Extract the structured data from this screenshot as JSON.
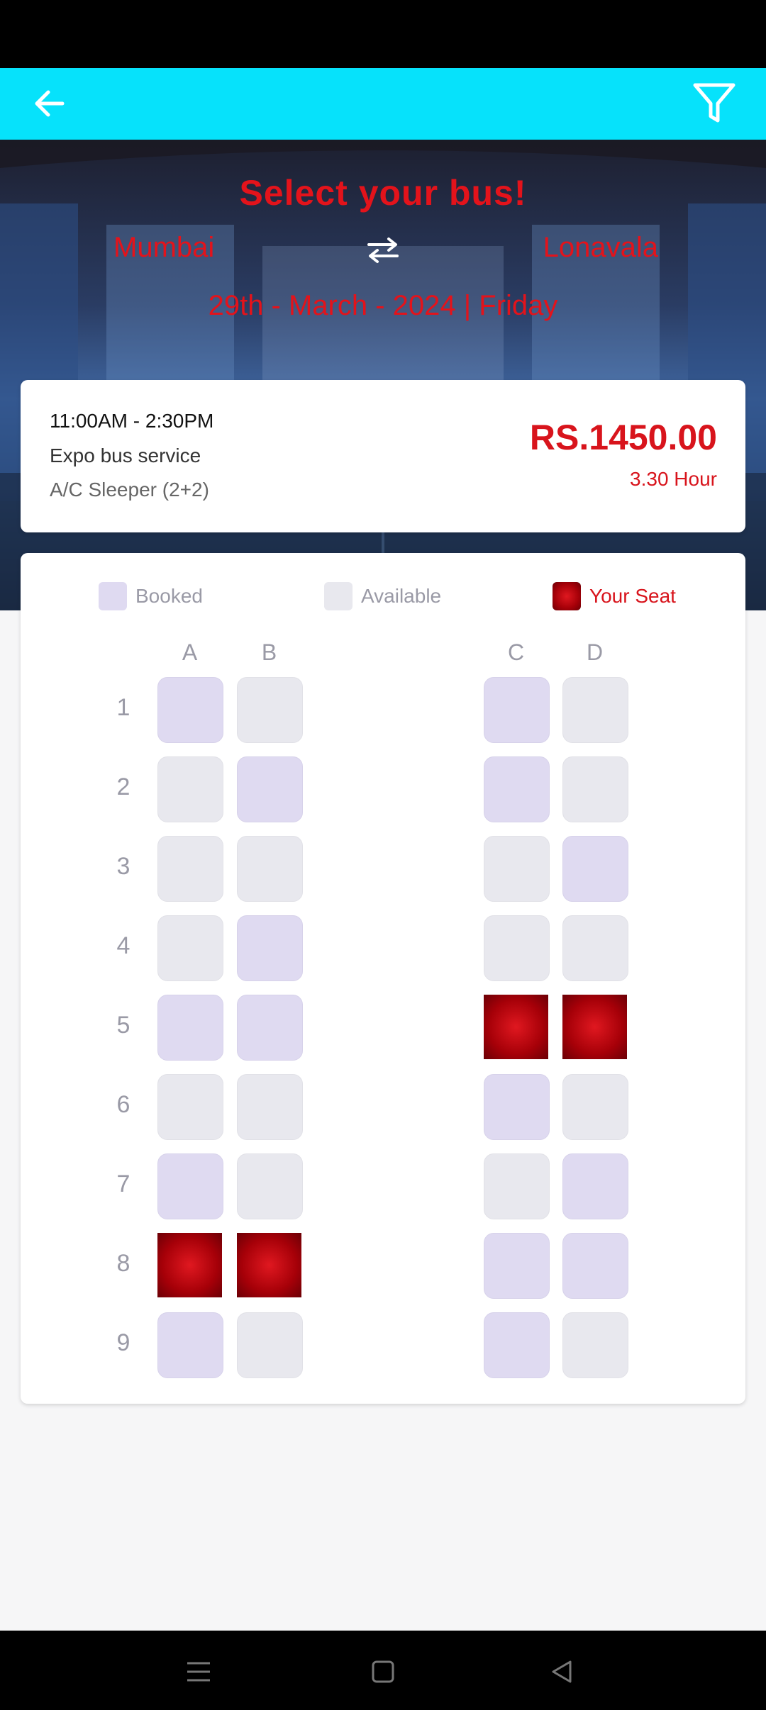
{
  "header": {
    "back_icon": "arrow-left-icon",
    "filter_icon": "filter-icon",
    "bar_color": "#06e2fb"
  },
  "hero": {
    "title": "Select your bus!",
    "from": "Mumbai",
    "to": "Lonavala",
    "swap_icon": "swap-arrows-icon",
    "date": "29th - March - 2024 | Friday"
  },
  "bus": {
    "time": "11:00AM - 2:30PM",
    "name": "Expo bus service",
    "type": "A/C Sleeper (2+2)",
    "price": "RS.1450.00",
    "duration": "3.30 Hour"
  },
  "legend": {
    "booked": "Booked",
    "available": "Available",
    "your_seat": "Your Seat"
  },
  "seat_map": {
    "columns": [
      "A",
      "B",
      "C",
      "D"
    ],
    "rows": [
      {
        "label": "1",
        "seats": [
          "booked",
          "available",
          "booked",
          "available"
        ]
      },
      {
        "label": "2",
        "seats": [
          "available",
          "booked",
          "booked",
          "available"
        ]
      },
      {
        "label": "3",
        "seats": [
          "available",
          "available",
          "available",
          "booked"
        ]
      },
      {
        "label": "4",
        "seats": [
          "available",
          "booked",
          "available",
          "available"
        ]
      },
      {
        "label": "5",
        "seats": [
          "booked",
          "booked",
          "yours",
          "yours"
        ]
      },
      {
        "label": "6",
        "seats": [
          "available",
          "available",
          "booked",
          "available"
        ]
      },
      {
        "label": "7",
        "seats": [
          "booked",
          "available",
          "available",
          "booked"
        ]
      },
      {
        "label": "8",
        "seats": [
          "yours",
          "yours",
          "booked",
          "booked"
        ]
      },
      {
        "label": "9",
        "seats": [
          "booked",
          "available",
          "booked",
          "available"
        ]
      }
    ]
  },
  "colors": {
    "accent_red": "#e3131b",
    "booked": "#dfdaf1",
    "available": "#e8e8ee",
    "your_seat": "#b0000a"
  },
  "system_nav": {
    "menu_icon": "menu-icon",
    "home_icon": "home-icon",
    "back_icon": "back-triangle-icon"
  }
}
